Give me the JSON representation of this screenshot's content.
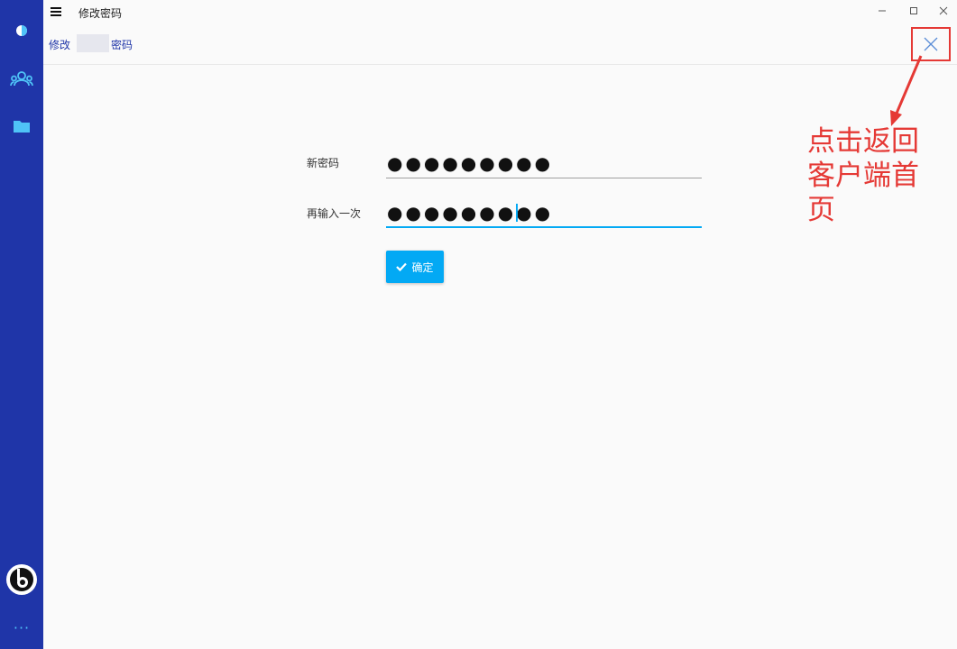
{
  "window": {
    "title": "修改密码",
    "controls": {
      "minimize_icon": "minimize-icon",
      "maximize_icon": "maximize-icon",
      "close_icon": "close-icon"
    }
  },
  "sidebar": {
    "items": [
      {
        "icon": "app-logo-icon"
      },
      {
        "icon": "users-icon"
      },
      {
        "icon": "folder-icon"
      }
    ],
    "bottom": [
      {
        "icon": "avatar"
      },
      {
        "icon": "more-icon",
        "label": "···"
      }
    ],
    "colors": {
      "background": "#1f35a8",
      "icon": "#4fc3f7"
    }
  },
  "header": {
    "breadcrumb_prefix": "修改",
    "breadcrumb_suffix": "密码",
    "close_icon": "close-icon"
  },
  "form": {
    "new_password": {
      "label": "新密码",
      "value": "●●●●●●●●●"
    },
    "confirm_password": {
      "label": "再输入一次",
      "value": "●●●●●●●●●"
    },
    "submit": {
      "label": "确定",
      "icon": "check-icon"
    }
  },
  "annotation": {
    "text": "点击返回客户端首页",
    "color": "#e53935"
  },
  "colors": {
    "accent": "#03a9f4",
    "primary": "#1f35a8"
  }
}
